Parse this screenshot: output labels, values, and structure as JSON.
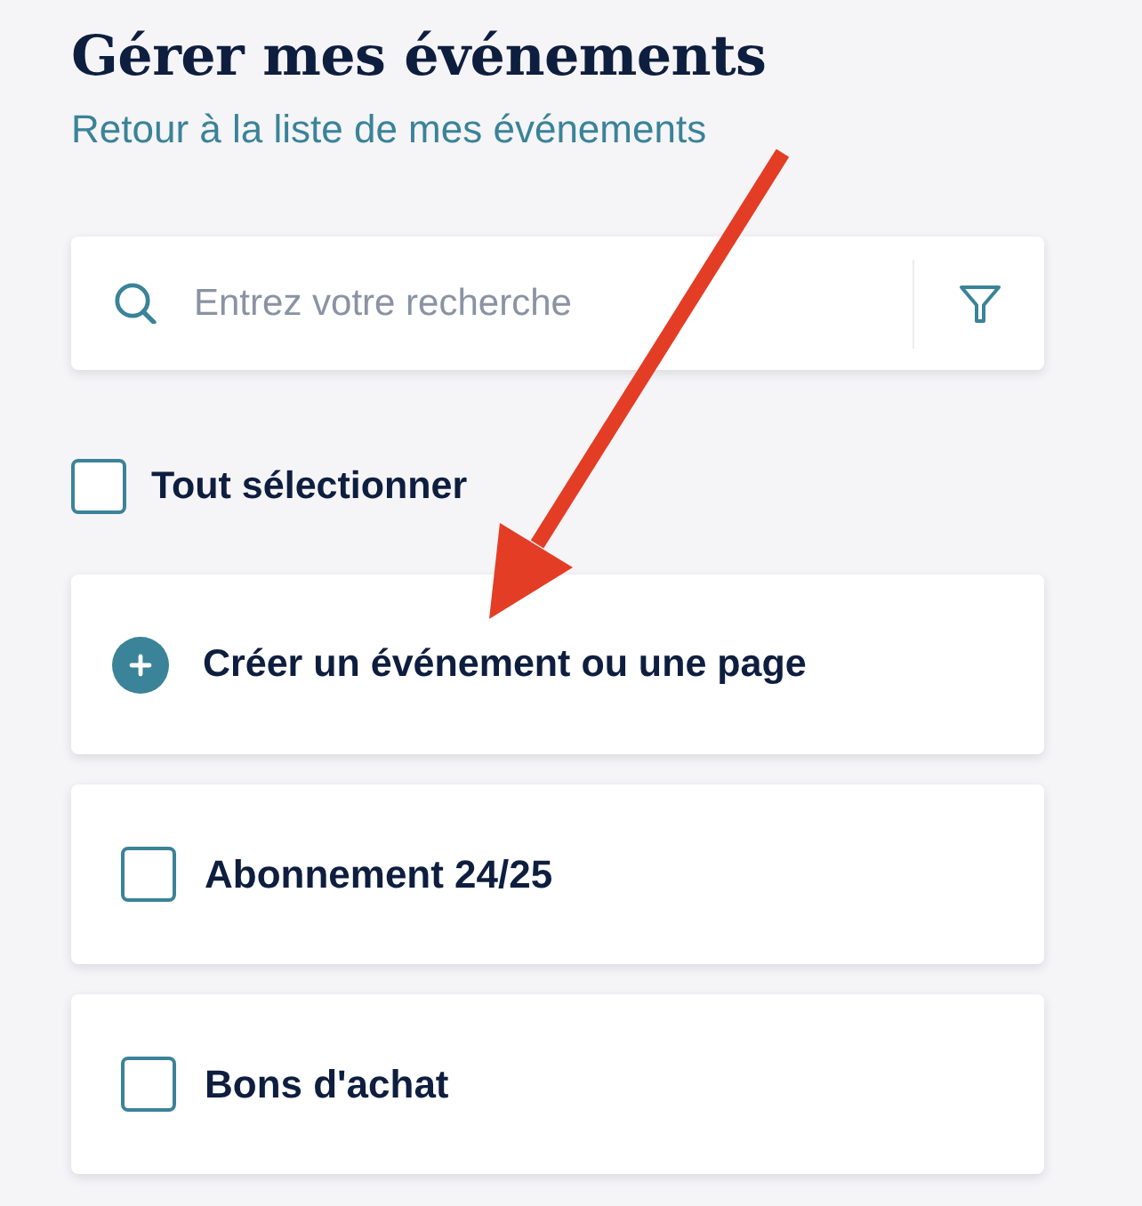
{
  "header": {
    "title": "Gérer mes événements",
    "back_link": "Retour à la liste de mes événements"
  },
  "search": {
    "placeholder": "Entrez votre recherche"
  },
  "select_all": {
    "label": "Tout sélectionner",
    "checked": false
  },
  "items": [
    {
      "kind": "create",
      "label": "Créer un événement ou une page"
    },
    {
      "kind": "event",
      "label": "Abonnement 24/25",
      "checked": false
    },
    {
      "kind": "event",
      "label": "Bons d'achat",
      "checked": false
    }
  ]
}
